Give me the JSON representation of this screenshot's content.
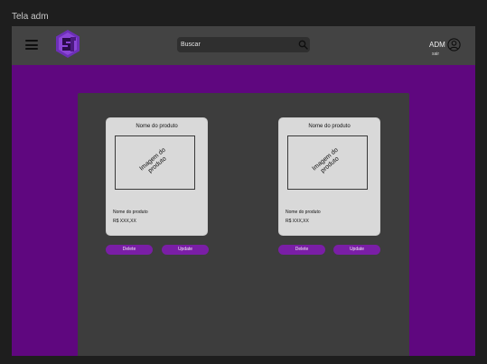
{
  "frame_label": "Tela adm",
  "header": {
    "search_placeholder": "Buscar",
    "user_label": "ADM",
    "logout_label": "sair"
  },
  "colors": {
    "accent": "#5f077f",
    "button": "#7a1ea6",
    "topbar": "#434343",
    "panel": "#3d3d3d",
    "card": "#d9d9d9"
  },
  "products": [
    {
      "title": "Nome do produto",
      "image_text": "Imagem do produto",
      "name": "Nome do produto",
      "price": "R$ XXX,XX",
      "delete_label": "Delete",
      "update_label": "Update"
    },
    {
      "title": "Nome do produto",
      "image_text": "Imagem do produto",
      "name": "Nome do produto",
      "price": "R$ XXX,XX",
      "delete_label": "Delete",
      "update_label": "Update"
    }
  ]
}
